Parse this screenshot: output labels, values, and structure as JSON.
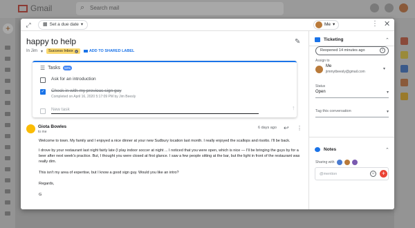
{
  "app": {
    "name": "Gmail",
    "search_placeholder": "Search mail"
  },
  "toolbar": {
    "due_date_label": "Set a due date",
    "me_label": "Me"
  },
  "email": {
    "subject": "happy to help",
    "folder": "In Jim",
    "label": "Success Inbox",
    "add_label": "ADD TO SHARED LABEL"
  },
  "tasks": {
    "title": "Tasks",
    "percent": "50%",
    "items": [
      {
        "text": "Ask for an introduction",
        "done": false,
        "sub": ""
      },
      {
        "text": "Check in with my previous sign guy",
        "done": true,
        "sub": "Completed on April 16, 2020 5:17:09 PM by Jim Beesly"
      }
    ],
    "new_task_placeholder": "New task"
  },
  "message": {
    "sender": "Giota Bowles",
    "to": "to me",
    "time": "6 days ago",
    "paragraphs": [
      "Welcome to town. My family and I enjoyed a nice dinner at your new Sudbury location last month. I really enjoyed the scallops and risotto. I'll be back.",
      "I drove by your restaurant last night fairly late (I play indoor soccer at night ... I noticed that you were open, which is nice — I'll be bringing the guys by for a beer after next week's practice. But, I thought you were closed at first glance. I saw a few people sitting at the bar, but the light in front of the restaurant was really dim.",
      "This isn't my area of expertise, but I know a good sign guy. Would you like an intro?",
      "Regards,",
      "G"
    ]
  },
  "panel": {
    "ticketing_title": "Ticketing",
    "reopened_text": "Reopened 14 minutes ago",
    "assign_label": "Assign to",
    "assignee_name": "Me",
    "assignee_email": "jimmytbeesly@gmail.com",
    "status_label": "Status",
    "status_value": "Open",
    "tag_placeholder": "Tag this conversation",
    "notes_title": "Notes",
    "sharing_label": "Sharing with",
    "mention_placeholder": "@mention"
  },
  "colors": {
    "accent": "#1a73e8",
    "label_bg": "#fbd96f",
    "add_note": "#ea4335"
  }
}
